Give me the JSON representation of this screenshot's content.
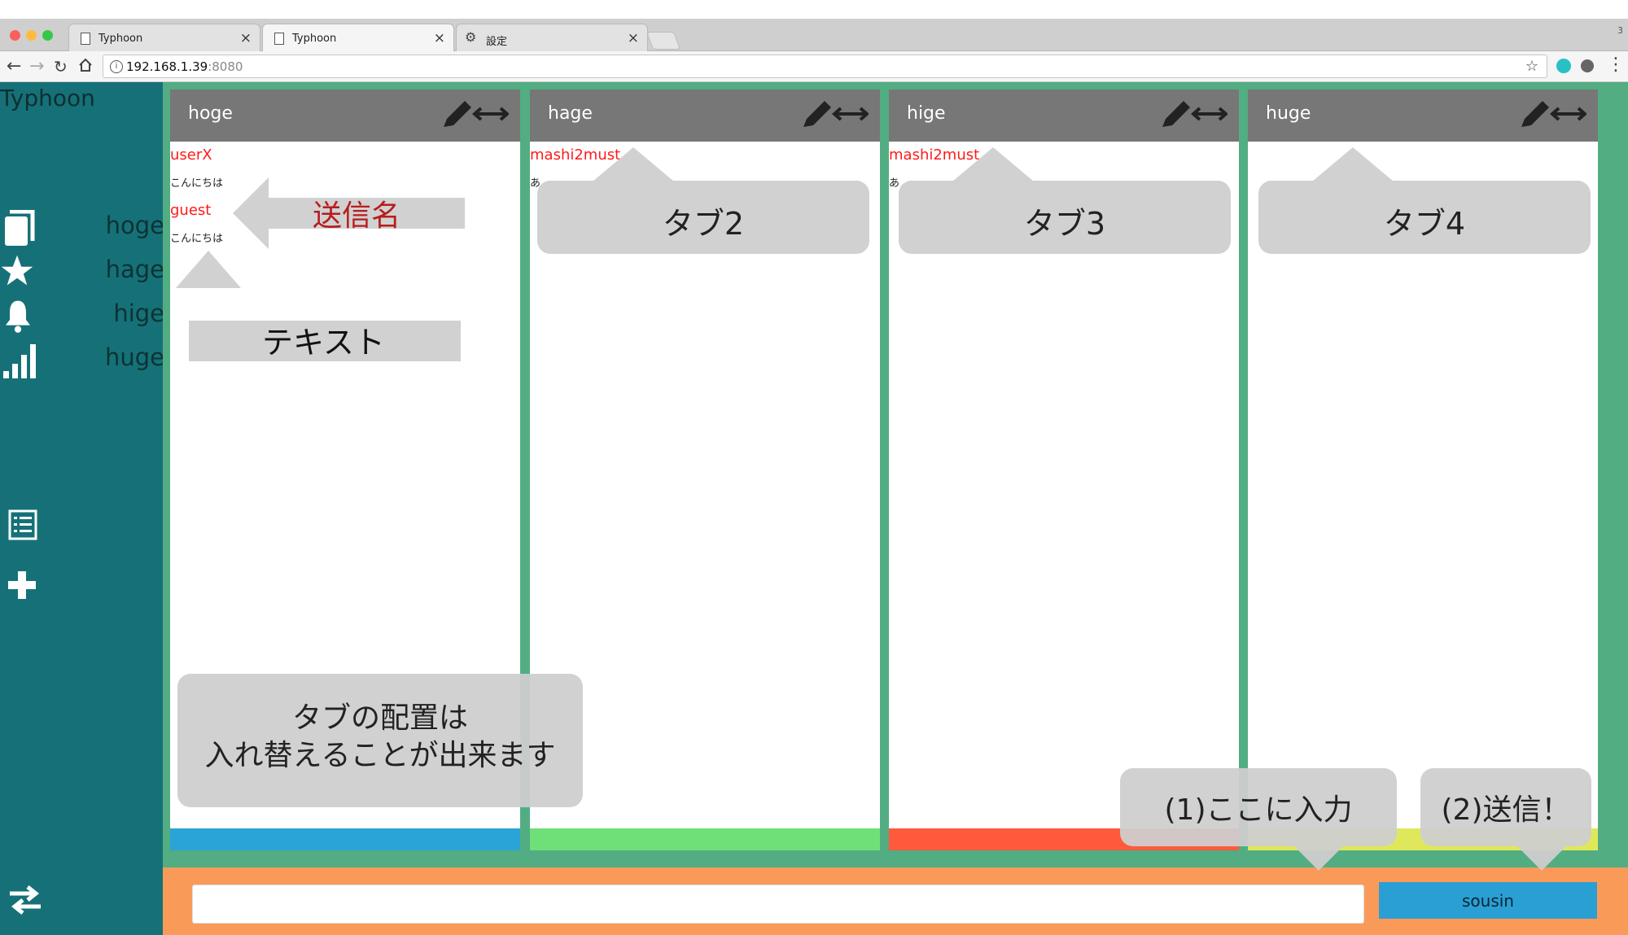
{
  "browser": {
    "tabs": [
      {
        "label": "Typhoon"
      },
      {
        "label": "Typhoon"
      },
      {
        "label": "設定"
      }
    ],
    "url_host": "192.168.1.39",
    "url_port": ":8080",
    "corner_number": "3"
  },
  "app": {
    "title": "Typhoon",
    "nav": [
      {
        "label": "hoge",
        "icon": "book-icon"
      },
      {
        "label": "hage",
        "icon": "star-icon"
      },
      {
        "label": "hige",
        "icon": "bell-icon"
      },
      {
        "label": "huge",
        "icon": "signal-bars-icon"
      }
    ],
    "columns": [
      {
        "title": "hoge",
        "color": "#2aa4d6",
        "messages": [
          {
            "name": "userX",
            "text": "こんにちは"
          },
          {
            "name": "guest",
            "text": "こんにちは"
          }
        ]
      },
      {
        "title": "hage",
        "color": "#6fdf78",
        "messages": [
          {
            "name": "mashi2must",
            "text": "あ"
          }
        ]
      },
      {
        "title": "hige",
        "color": "#ff5a3c",
        "messages": [
          {
            "name": "mashi2must",
            "text": "あ"
          }
        ]
      },
      {
        "title": "huge",
        "color": "#dfe85a",
        "messages": []
      }
    ],
    "input_value": "",
    "send_label": "sousin"
  },
  "annotations": {
    "sender_name": "送信名",
    "text": "テキスト",
    "tab2": "タブ2",
    "tab3": "タブ3",
    "tab4": "タブ4",
    "reorder_line1": "タブの配置は",
    "reorder_line2": "入れ替えることが出来ます",
    "input_here": "(1)ここに入力",
    "send": "(2)送信！"
  },
  "colors": {
    "sidebar": "#157177",
    "main": "#52ad83",
    "footer": "#f99a59",
    "send_button": "#2a9fd4",
    "sender_name": "#ff1a1a"
  }
}
